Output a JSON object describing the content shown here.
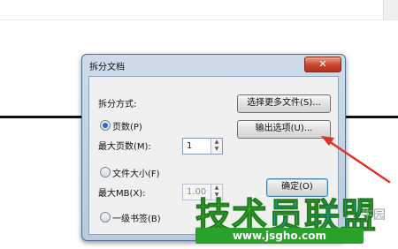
{
  "dialog": {
    "title": "拆分文档",
    "close_glyph": "✕",
    "split_mode_label": "拆分方式:",
    "radio_pages": "页数(P)",
    "max_pages_label": "最大页数(M):",
    "max_pages_value": "1",
    "radio_filesize": "文件大小(F)",
    "max_mb_label": "最大MB(X):",
    "max_mb_value": "1.00",
    "radio_bookmark": "一级书签(B)",
    "btn_select_more": "选择更多文件(S)...",
    "btn_output_options": "输出选项(U)...",
    "btn_ok": "确定(O)",
    "selected_mode": "pages"
  },
  "watermark": {
    "main_a": "技术",
    "main_b": "员联盟",
    "url": "www.jsgho.com",
    "side": "牛园"
  },
  "colors": {
    "arrow": "#e0322b",
    "watermark_green": "#3fb536"
  },
  "icons": {
    "spin_up": "▲",
    "spin_down": "▼"
  }
}
